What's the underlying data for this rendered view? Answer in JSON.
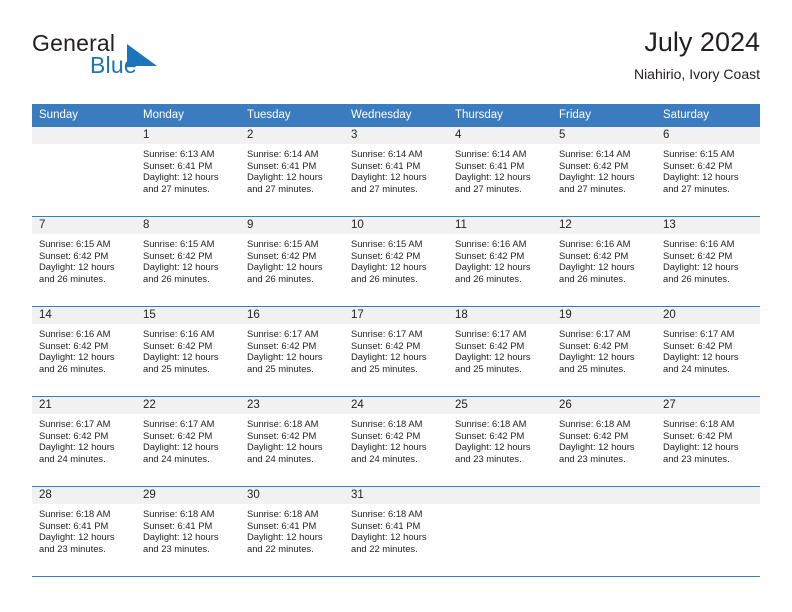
{
  "brand": {
    "name_part1": "General",
    "name_part2": "Blue",
    "mark_color": "#1b75bc"
  },
  "header": {
    "title": "July 2024",
    "subtitle": "Niahirio, Ivory Coast"
  },
  "theme": {
    "header_row_bg": "#3a7cbf",
    "daynum_band_bg": "#f1f1f1",
    "row_divider": "#3a7cbf",
    "text": "#231f20"
  },
  "weekday_headers": [
    "Sunday",
    "Monday",
    "Tuesday",
    "Wednesday",
    "Thursday",
    "Friday",
    "Saturday"
  ],
  "weeks": [
    [
      {
        "day": "",
        "sunrise": "",
        "sunset": "",
        "daylight_line1": "",
        "daylight_line2": ""
      },
      {
        "day": "1",
        "sunrise": "Sunrise: 6:13 AM",
        "sunset": "Sunset: 6:41 PM",
        "daylight_line1": "Daylight: 12 hours",
        "daylight_line2": "and 27 minutes."
      },
      {
        "day": "2",
        "sunrise": "Sunrise: 6:14 AM",
        "sunset": "Sunset: 6:41 PM",
        "daylight_line1": "Daylight: 12 hours",
        "daylight_line2": "and 27 minutes."
      },
      {
        "day": "3",
        "sunrise": "Sunrise: 6:14 AM",
        "sunset": "Sunset: 6:41 PM",
        "daylight_line1": "Daylight: 12 hours",
        "daylight_line2": "and 27 minutes."
      },
      {
        "day": "4",
        "sunrise": "Sunrise: 6:14 AM",
        "sunset": "Sunset: 6:41 PM",
        "daylight_line1": "Daylight: 12 hours",
        "daylight_line2": "and 27 minutes."
      },
      {
        "day": "5",
        "sunrise": "Sunrise: 6:14 AM",
        "sunset": "Sunset: 6:42 PM",
        "daylight_line1": "Daylight: 12 hours",
        "daylight_line2": "and 27 minutes."
      },
      {
        "day": "6",
        "sunrise": "Sunrise: 6:15 AM",
        "sunset": "Sunset: 6:42 PM",
        "daylight_line1": "Daylight: 12 hours",
        "daylight_line2": "and 27 minutes."
      }
    ],
    [
      {
        "day": "7",
        "sunrise": "Sunrise: 6:15 AM",
        "sunset": "Sunset: 6:42 PM",
        "daylight_line1": "Daylight: 12 hours",
        "daylight_line2": "and 26 minutes."
      },
      {
        "day": "8",
        "sunrise": "Sunrise: 6:15 AM",
        "sunset": "Sunset: 6:42 PM",
        "daylight_line1": "Daylight: 12 hours",
        "daylight_line2": "and 26 minutes."
      },
      {
        "day": "9",
        "sunrise": "Sunrise: 6:15 AM",
        "sunset": "Sunset: 6:42 PM",
        "daylight_line1": "Daylight: 12 hours",
        "daylight_line2": "and 26 minutes."
      },
      {
        "day": "10",
        "sunrise": "Sunrise: 6:15 AM",
        "sunset": "Sunset: 6:42 PM",
        "daylight_line1": "Daylight: 12 hours",
        "daylight_line2": "and 26 minutes."
      },
      {
        "day": "11",
        "sunrise": "Sunrise: 6:16 AM",
        "sunset": "Sunset: 6:42 PM",
        "daylight_line1": "Daylight: 12 hours",
        "daylight_line2": "and 26 minutes."
      },
      {
        "day": "12",
        "sunrise": "Sunrise: 6:16 AM",
        "sunset": "Sunset: 6:42 PM",
        "daylight_line1": "Daylight: 12 hours",
        "daylight_line2": "and 26 minutes."
      },
      {
        "day": "13",
        "sunrise": "Sunrise: 6:16 AM",
        "sunset": "Sunset: 6:42 PM",
        "daylight_line1": "Daylight: 12 hours",
        "daylight_line2": "and 26 minutes."
      }
    ],
    [
      {
        "day": "14",
        "sunrise": "Sunrise: 6:16 AM",
        "sunset": "Sunset: 6:42 PM",
        "daylight_line1": "Daylight: 12 hours",
        "daylight_line2": "and 26 minutes."
      },
      {
        "day": "15",
        "sunrise": "Sunrise: 6:16 AM",
        "sunset": "Sunset: 6:42 PM",
        "daylight_line1": "Daylight: 12 hours",
        "daylight_line2": "and 25 minutes."
      },
      {
        "day": "16",
        "sunrise": "Sunrise: 6:17 AM",
        "sunset": "Sunset: 6:42 PM",
        "daylight_line1": "Daylight: 12 hours",
        "daylight_line2": "and 25 minutes."
      },
      {
        "day": "17",
        "sunrise": "Sunrise: 6:17 AM",
        "sunset": "Sunset: 6:42 PM",
        "daylight_line1": "Daylight: 12 hours",
        "daylight_line2": "and 25 minutes."
      },
      {
        "day": "18",
        "sunrise": "Sunrise: 6:17 AM",
        "sunset": "Sunset: 6:42 PM",
        "daylight_line1": "Daylight: 12 hours",
        "daylight_line2": "and 25 minutes."
      },
      {
        "day": "19",
        "sunrise": "Sunrise: 6:17 AM",
        "sunset": "Sunset: 6:42 PM",
        "daylight_line1": "Daylight: 12 hours",
        "daylight_line2": "and 25 minutes."
      },
      {
        "day": "20",
        "sunrise": "Sunrise: 6:17 AM",
        "sunset": "Sunset: 6:42 PM",
        "daylight_line1": "Daylight: 12 hours",
        "daylight_line2": "and 24 minutes."
      }
    ],
    [
      {
        "day": "21",
        "sunrise": "Sunrise: 6:17 AM",
        "sunset": "Sunset: 6:42 PM",
        "daylight_line1": "Daylight: 12 hours",
        "daylight_line2": "and 24 minutes."
      },
      {
        "day": "22",
        "sunrise": "Sunrise: 6:17 AM",
        "sunset": "Sunset: 6:42 PM",
        "daylight_line1": "Daylight: 12 hours",
        "daylight_line2": "and 24 minutes."
      },
      {
        "day": "23",
        "sunrise": "Sunrise: 6:18 AM",
        "sunset": "Sunset: 6:42 PM",
        "daylight_line1": "Daylight: 12 hours",
        "daylight_line2": "and 24 minutes."
      },
      {
        "day": "24",
        "sunrise": "Sunrise: 6:18 AM",
        "sunset": "Sunset: 6:42 PM",
        "daylight_line1": "Daylight: 12 hours",
        "daylight_line2": "and 24 minutes."
      },
      {
        "day": "25",
        "sunrise": "Sunrise: 6:18 AM",
        "sunset": "Sunset: 6:42 PM",
        "daylight_line1": "Daylight: 12 hours",
        "daylight_line2": "and 23 minutes."
      },
      {
        "day": "26",
        "sunrise": "Sunrise: 6:18 AM",
        "sunset": "Sunset: 6:42 PM",
        "daylight_line1": "Daylight: 12 hours",
        "daylight_line2": "and 23 minutes."
      },
      {
        "day": "27",
        "sunrise": "Sunrise: 6:18 AM",
        "sunset": "Sunset: 6:42 PM",
        "daylight_line1": "Daylight: 12 hours",
        "daylight_line2": "and 23 minutes."
      }
    ],
    [
      {
        "day": "28",
        "sunrise": "Sunrise: 6:18 AM",
        "sunset": "Sunset: 6:41 PM",
        "daylight_line1": "Daylight: 12 hours",
        "daylight_line2": "and 23 minutes."
      },
      {
        "day": "29",
        "sunrise": "Sunrise: 6:18 AM",
        "sunset": "Sunset: 6:41 PM",
        "daylight_line1": "Daylight: 12 hours",
        "daylight_line2": "and 23 minutes."
      },
      {
        "day": "30",
        "sunrise": "Sunrise: 6:18 AM",
        "sunset": "Sunset: 6:41 PM",
        "daylight_line1": "Daylight: 12 hours",
        "daylight_line2": "and 22 minutes."
      },
      {
        "day": "31",
        "sunrise": "Sunrise: 6:18 AM",
        "sunset": "Sunset: 6:41 PM",
        "daylight_line1": "Daylight: 12 hours",
        "daylight_line2": "and 22 minutes."
      },
      {
        "day": "",
        "sunrise": "",
        "sunset": "",
        "daylight_line1": "",
        "daylight_line2": ""
      },
      {
        "day": "",
        "sunrise": "",
        "sunset": "",
        "daylight_line1": "",
        "daylight_line2": ""
      },
      {
        "day": "",
        "sunrise": "",
        "sunset": "",
        "daylight_line1": "",
        "daylight_line2": ""
      }
    ]
  ]
}
